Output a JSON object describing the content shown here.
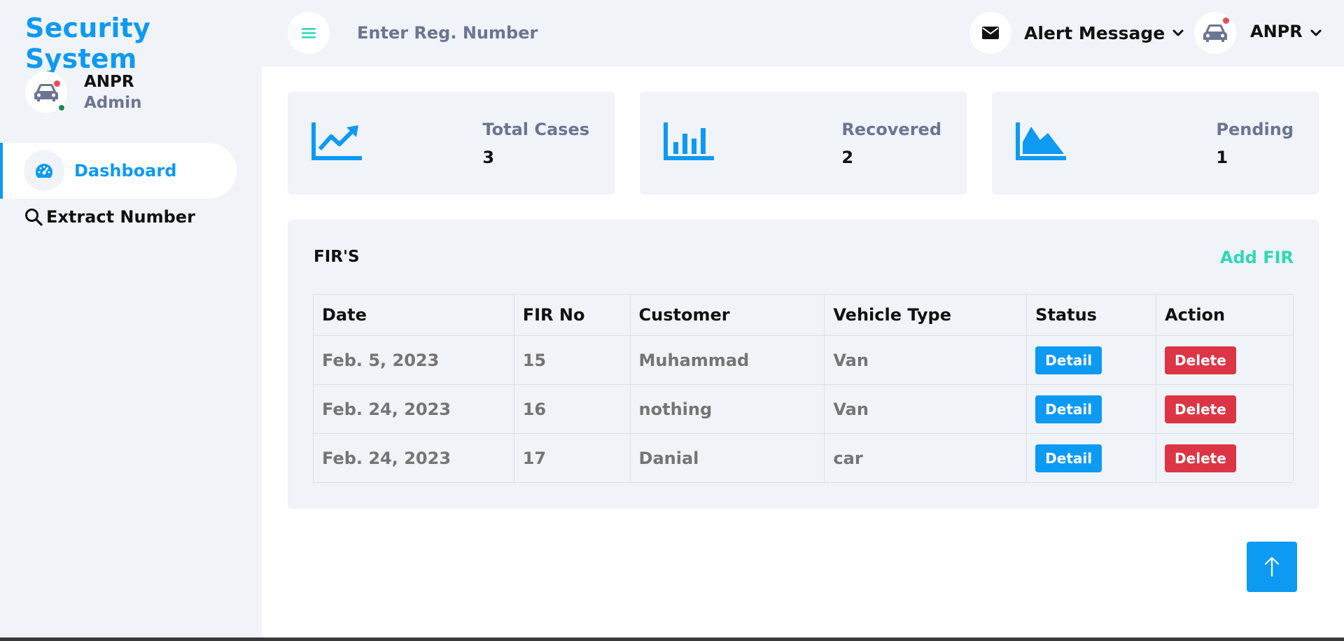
{
  "brand": {
    "title": "Security System"
  },
  "profile": {
    "name": "ANPR",
    "role": "Admin"
  },
  "sidebar": {
    "items": [
      {
        "label": "Dashboard",
        "icon": "dashboard-gauge-icon",
        "active": true
      },
      {
        "label": "Extract Number",
        "icon": "search-icon",
        "active": false
      }
    ]
  },
  "header": {
    "search": {
      "placeholder": "Enter Reg. Number",
      "value": ""
    },
    "alert_label": "Alert Message",
    "user_label": "ANPR"
  },
  "stats": [
    {
      "title": "Total Cases",
      "value": "3",
      "icon": "chart-line-icon"
    },
    {
      "title": "Recovered",
      "value": "2",
      "icon": "chart-bar-icon"
    },
    {
      "title": "Pending",
      "value": "1",
      "icon": "chart-area-icon"
    }
  ],
  "fir": {
    "title": "FIR'S",
    "add_label": "Add FIR",
    "columns": [
      "Date",
      "FIR No",
      "Customer",
      "Vehicle Type",
      "Status",
      "Action"
    ],
    "rows": [
      {
        "date": "Feb. 5, 2023",
        "fir_no": "15",
        "customer": "Muhammad",
        "vehicle_type": "Van",
        "status_btn": "Detail",
        "action_btn": "Delete"
      },
      {
        "date": "Feb. 24, 2023",
        "fir_no": "16",
        "customer": "nothing",
        "vehicle_type": "Van",
        "status_btn": "Detail",
        "action_btn": "Delete"
      },
      {
        "date": "Feb. 24, 2023",
        "fir_no": "17",
        "customer": "Danial",
        "vehicle_type": "car",
        "status_btn": "Detail",
        "action_btn": "Delete"
      }
    ]
  },
  "colors": {
    "primary": "#0d9af2",
    "accent_green": "#2ed8b6",
    "danger": "#dc3545",
    "panel_bg": "#f0f3f8"
  }
}
